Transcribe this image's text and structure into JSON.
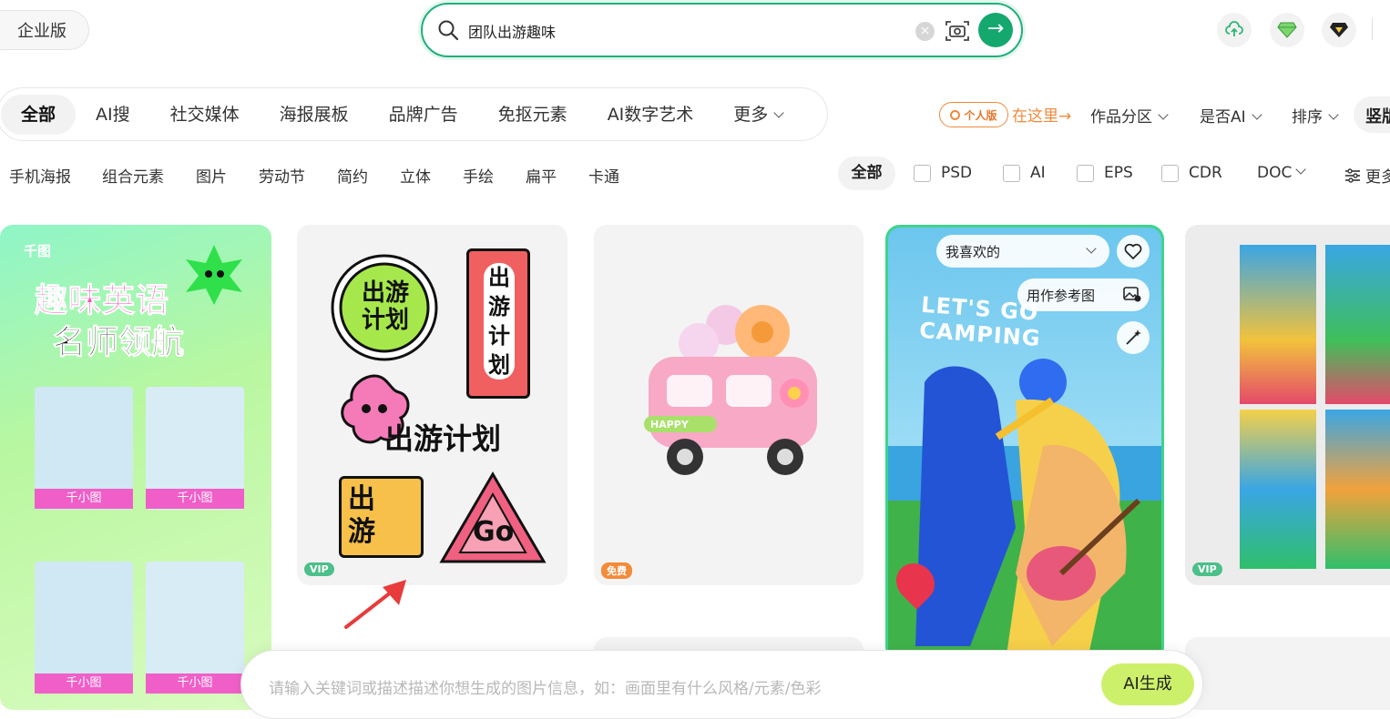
{
  "header": {
    "edition_label": "企业版",
    "search_value": "团队出游趣味",
    "search_clear": "×",
    "search_go": "→"
  },
  "categories": [
    "全部",
    "AI搜",
    "社交媒体",
    "海报展板",
    "品牌广告",
    "免抠元素",
    "AI数字艺术",
    "更多"
  ],
  "right_filters": {
    "personal_badge": "个人版",
    "here_link": "在这里→",
    "works_zone": "作品分区",
    "is_ai": "是否AI",
    "sort": "排序",
    "vertical": "竖版"
  },
  "tags": [
    "手机海报",
    "组合元素",
    "图片",
    "劳动节",
    "简约",
    "立体",
    "手绘",
    "扁平",
    "卡通"
  ],
  "formats": {
    "all": "全部",
    "items": [
      "PSD",
      "AI",
      "EPS",
      "CDR"
    ],
    "doc": "DOC",
    "more": "更多"
  },
  "cards": {
    "card1": {
      "logo": "千图",
      "title_line1": "趣味英语",
      "title_line2": "名师领航",
      "photo_label": "千小图"
    },
    "card2": {
      "sticker1": "出游计划",
      "sticker2": "出游计划",
      "sticker3": "出游计划",
      "sticker4": "出游",
      "sticker5": "Go",
      "badge": "VIP"
    },
    "card3": {
      "badge": "免费",
      "bus_text": "HAPPY"
    },
    "card4": {
      "fav_select": "我喜欢的",
      "ref_button": "用作参考图",
      "headline": "LET'S GO CAMPING"
    },
    "card5": {
      "badge": "VIP"
    }
  },
  "ai_bar": {
    "placeholder": "请输入关键词或描述描述你想生成的图片信息，如：画面里有什么风格/元素/色彩",
    "button": "AI生成"
  },
  "colors": {
    "accent_green": "#14a86e",
    "search_border": "#1fb07a",
    "orange": "#f08a3c",
    "ai_button": "#cdf06b"
  }
}
